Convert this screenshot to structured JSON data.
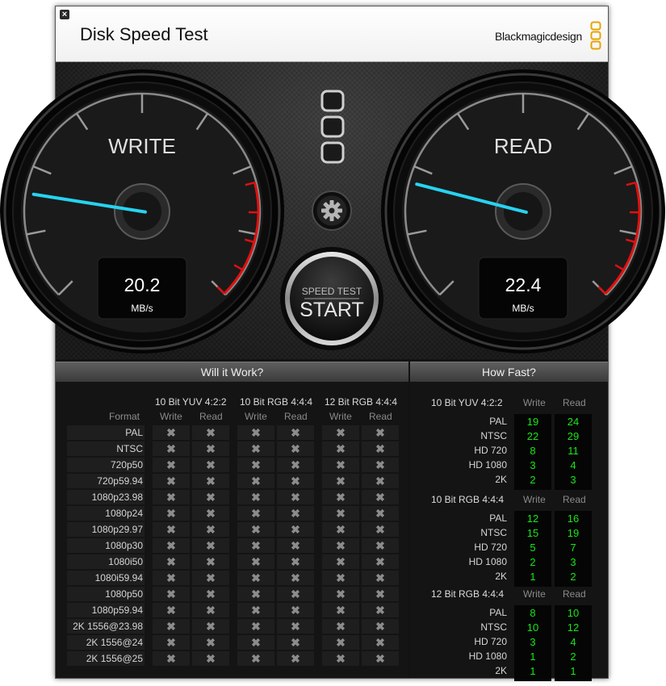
{
  "window": {
    "title": "Disk Speed Test",
    "brand": "Blackmagicdesign",
    "close_icon": "close-icon"
  },
  "gauges": {
    "write": {
      "label": "WRITE",
      "value": "20.2",
      "unit": "MB/s",
      "needle_fraction": 0.2
    },
    "read": {
      "label": "READ",
      "value": "22.4",
      "unit": "MB/s",
      "needle_fraction": 0.22
    }
  },
  "controls": {
    "settings_icon": "gear-icon",
    "start_top": "SPEED TEST",
    "start_main": "START"
  },
  "will_it_work": {
    "title": "Will it Work?",
    "format_header": "Format",
    "groups": [
      "10 Bit YUV 4:2:2",
      "10 Bit RGB 4:4:4",
      "12 Bit RGB 4:4:4"
    ],
    "write_label": "Write",
    "read_label": "Read",
    "formats": [
      "PAL",
      "NTSC",
      "720p50",
      "720p59.94",
      "1080p23.98",
      "1080p24",
      "1080p29.97",
      "1080p30",
      "1080i50",
      "1080i59.94",
      "1080p50",
      "1080p59.94",
      "2K 1556@23.98",
      "2K 1556@24",
      "2K 1556@25"
    ],
    "mark": "✖"
  },
  "how_fast": {
    "title": "How Fast?",
    "write_label": "Write",
    "read_label": "Read",
    "groups": [
      {
        "name": "10 Bit YUV 4:2:2",
        "rows": [
          {
            "label": "PAL",
            "write": "19",
            "read": "24"
          },
          {
            "label": "NTSC",
            "write": "22",
            "read": "29"
          },
          {
            "label": "HD 720",
            "write": "8",
            "read": "11"
          },
          {
            "label": "HD 1080",
            "write": "3",
            "read": "4"
          },
          {
            "label": "2K",
            "write": "2",
            "read": "3"
          }
        ]
      },
      {
        "name": "10 Bit RGB 4:4:4",
        "rows": [
          {
            "label": "PAL",
            "write": "12",
            "read": "16"
          },
          {
            "label": "NTSC",
            "write": "15",
            "read": "19"
          },
          {
            "label": "HD 720",
            "write": "5",
            "read": "7"
          },
          {
            "label": "HD 1080",
            "write": "2",
            "read": "3"
          },
          {
            "label": "2K",
            "write": "1",
            "read": "2"
          }
        ]
      },
      {
        "name": "12 Bit RGB 4:4:4",
        "rows": [
          {
            "label": "PAL",
            "write": "8",
            "read": "10"
          },
          {
            "label": "NTSC",
            "write": "10",
            "read": "12"
          },
          {
            "label": "HD 720",
            "write": "3",
            "read": "4"
          },
          {
            "label": "HD 1080",
            "write": "1",
            "read": "2"
          },
          {
            "label": "2K",
            "write": "1",
            "read": "1"
          }
        ]
      }
    ]
  },
  "colors": {
    "needle": "#27d3f0",
    "redzone": "#e01010",
    "fast_value": "#19e619"
  }
}
